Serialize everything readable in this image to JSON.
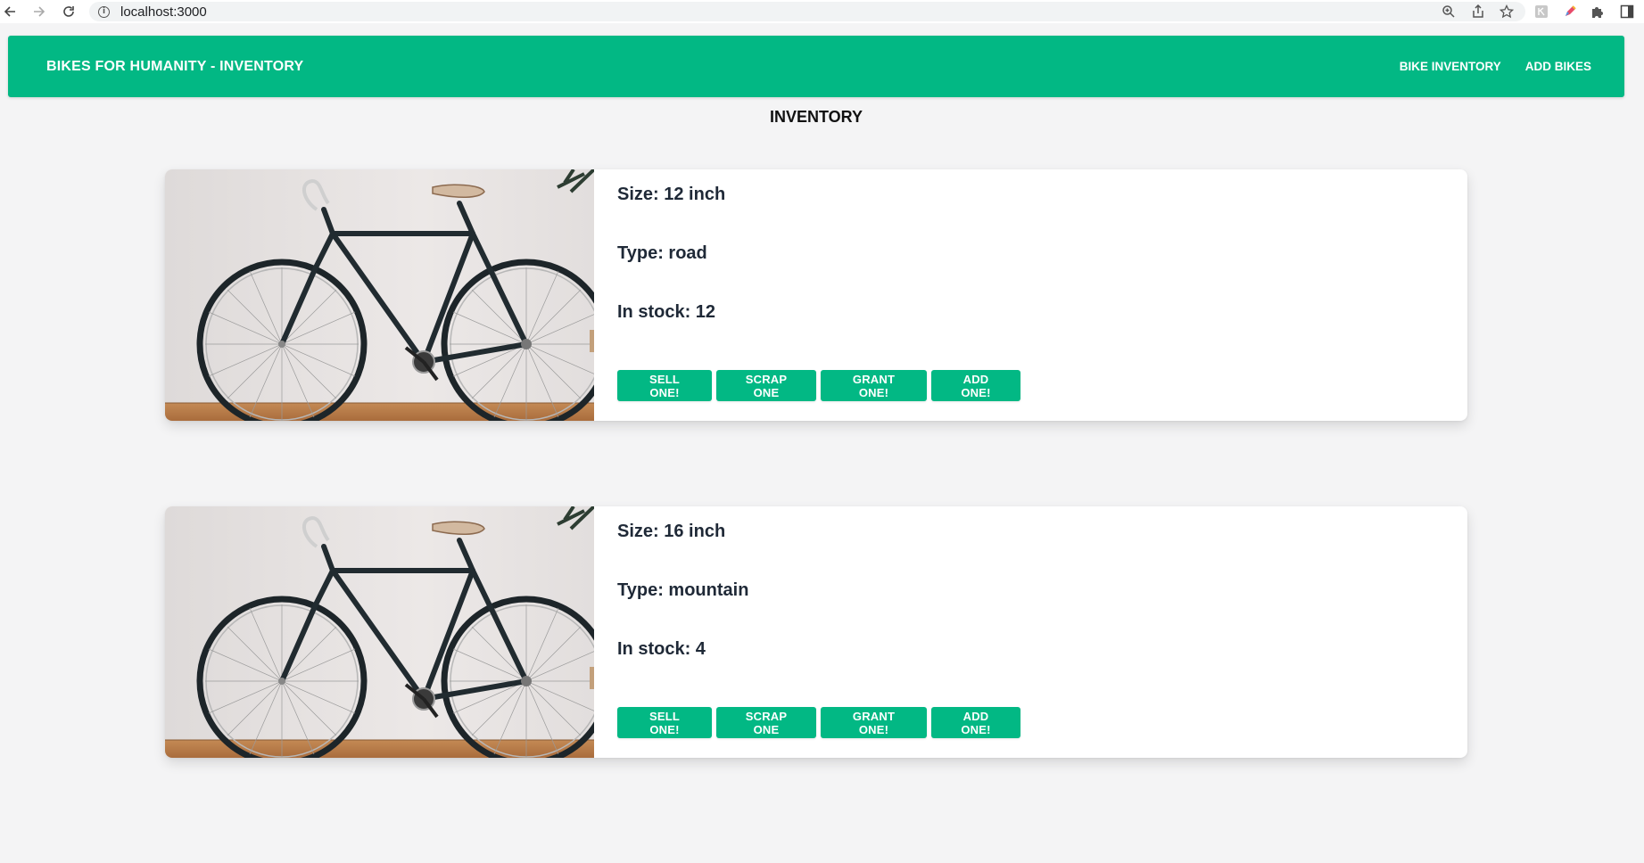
{
  "browser": {
    "url": "localhost:3000"
  },
  "header": {
    "brand": "BIKES FOR HUMANITY - INVENTORY",
    "nav": [
      "BIKE INVENTORY",
      "ADD BIKES"
    ]
  },
  "page": {
    "title": "INVENTORY"
  },
  "bikes": [
    {
      "size_label": "Size:",
      "size": "12 inch",
      "type_label": "Type:",
      "type": "road",
      "stock_label": "In stock:",
      "stock": "12",
      "actions": [
        "SELL ONE!",
        "SCRAP ONE",
        "GRANT ONE!",
        "ADD ONE!"
      ],
      "image": "bicycle-photo"
    },
    {
      "size_label": "Size:",
      "size": "16 inch",
      "type_label": "Type:",
      "type": "mountain",
      "stock_label": "In stock:",
      "stock": "4",
      "actions": [
        "SELL ONE!",
        "SCRAP ONE",
        "GRANT ONE!",
        "ADD ONE!"
      ],
      "image": "bicycle-photo"
    }
  ],
  "colors": {
    "accent": "#02b884",
    "background": "#f4f4f5",
    "card": "#ffffff",
    "text": "#1f2937"
  },
  "icons": {
    "browser": [
      "back-icon",
      "forward-icon",
      "reload-icon",
      "info-icon",
      "zoom-icon",
      "share-icon",
      "star-icon",
      "extension-icon",
      "pen-icon",
      "puzzle-icon",
      "sidebar-icon"
    ]
  }
}
